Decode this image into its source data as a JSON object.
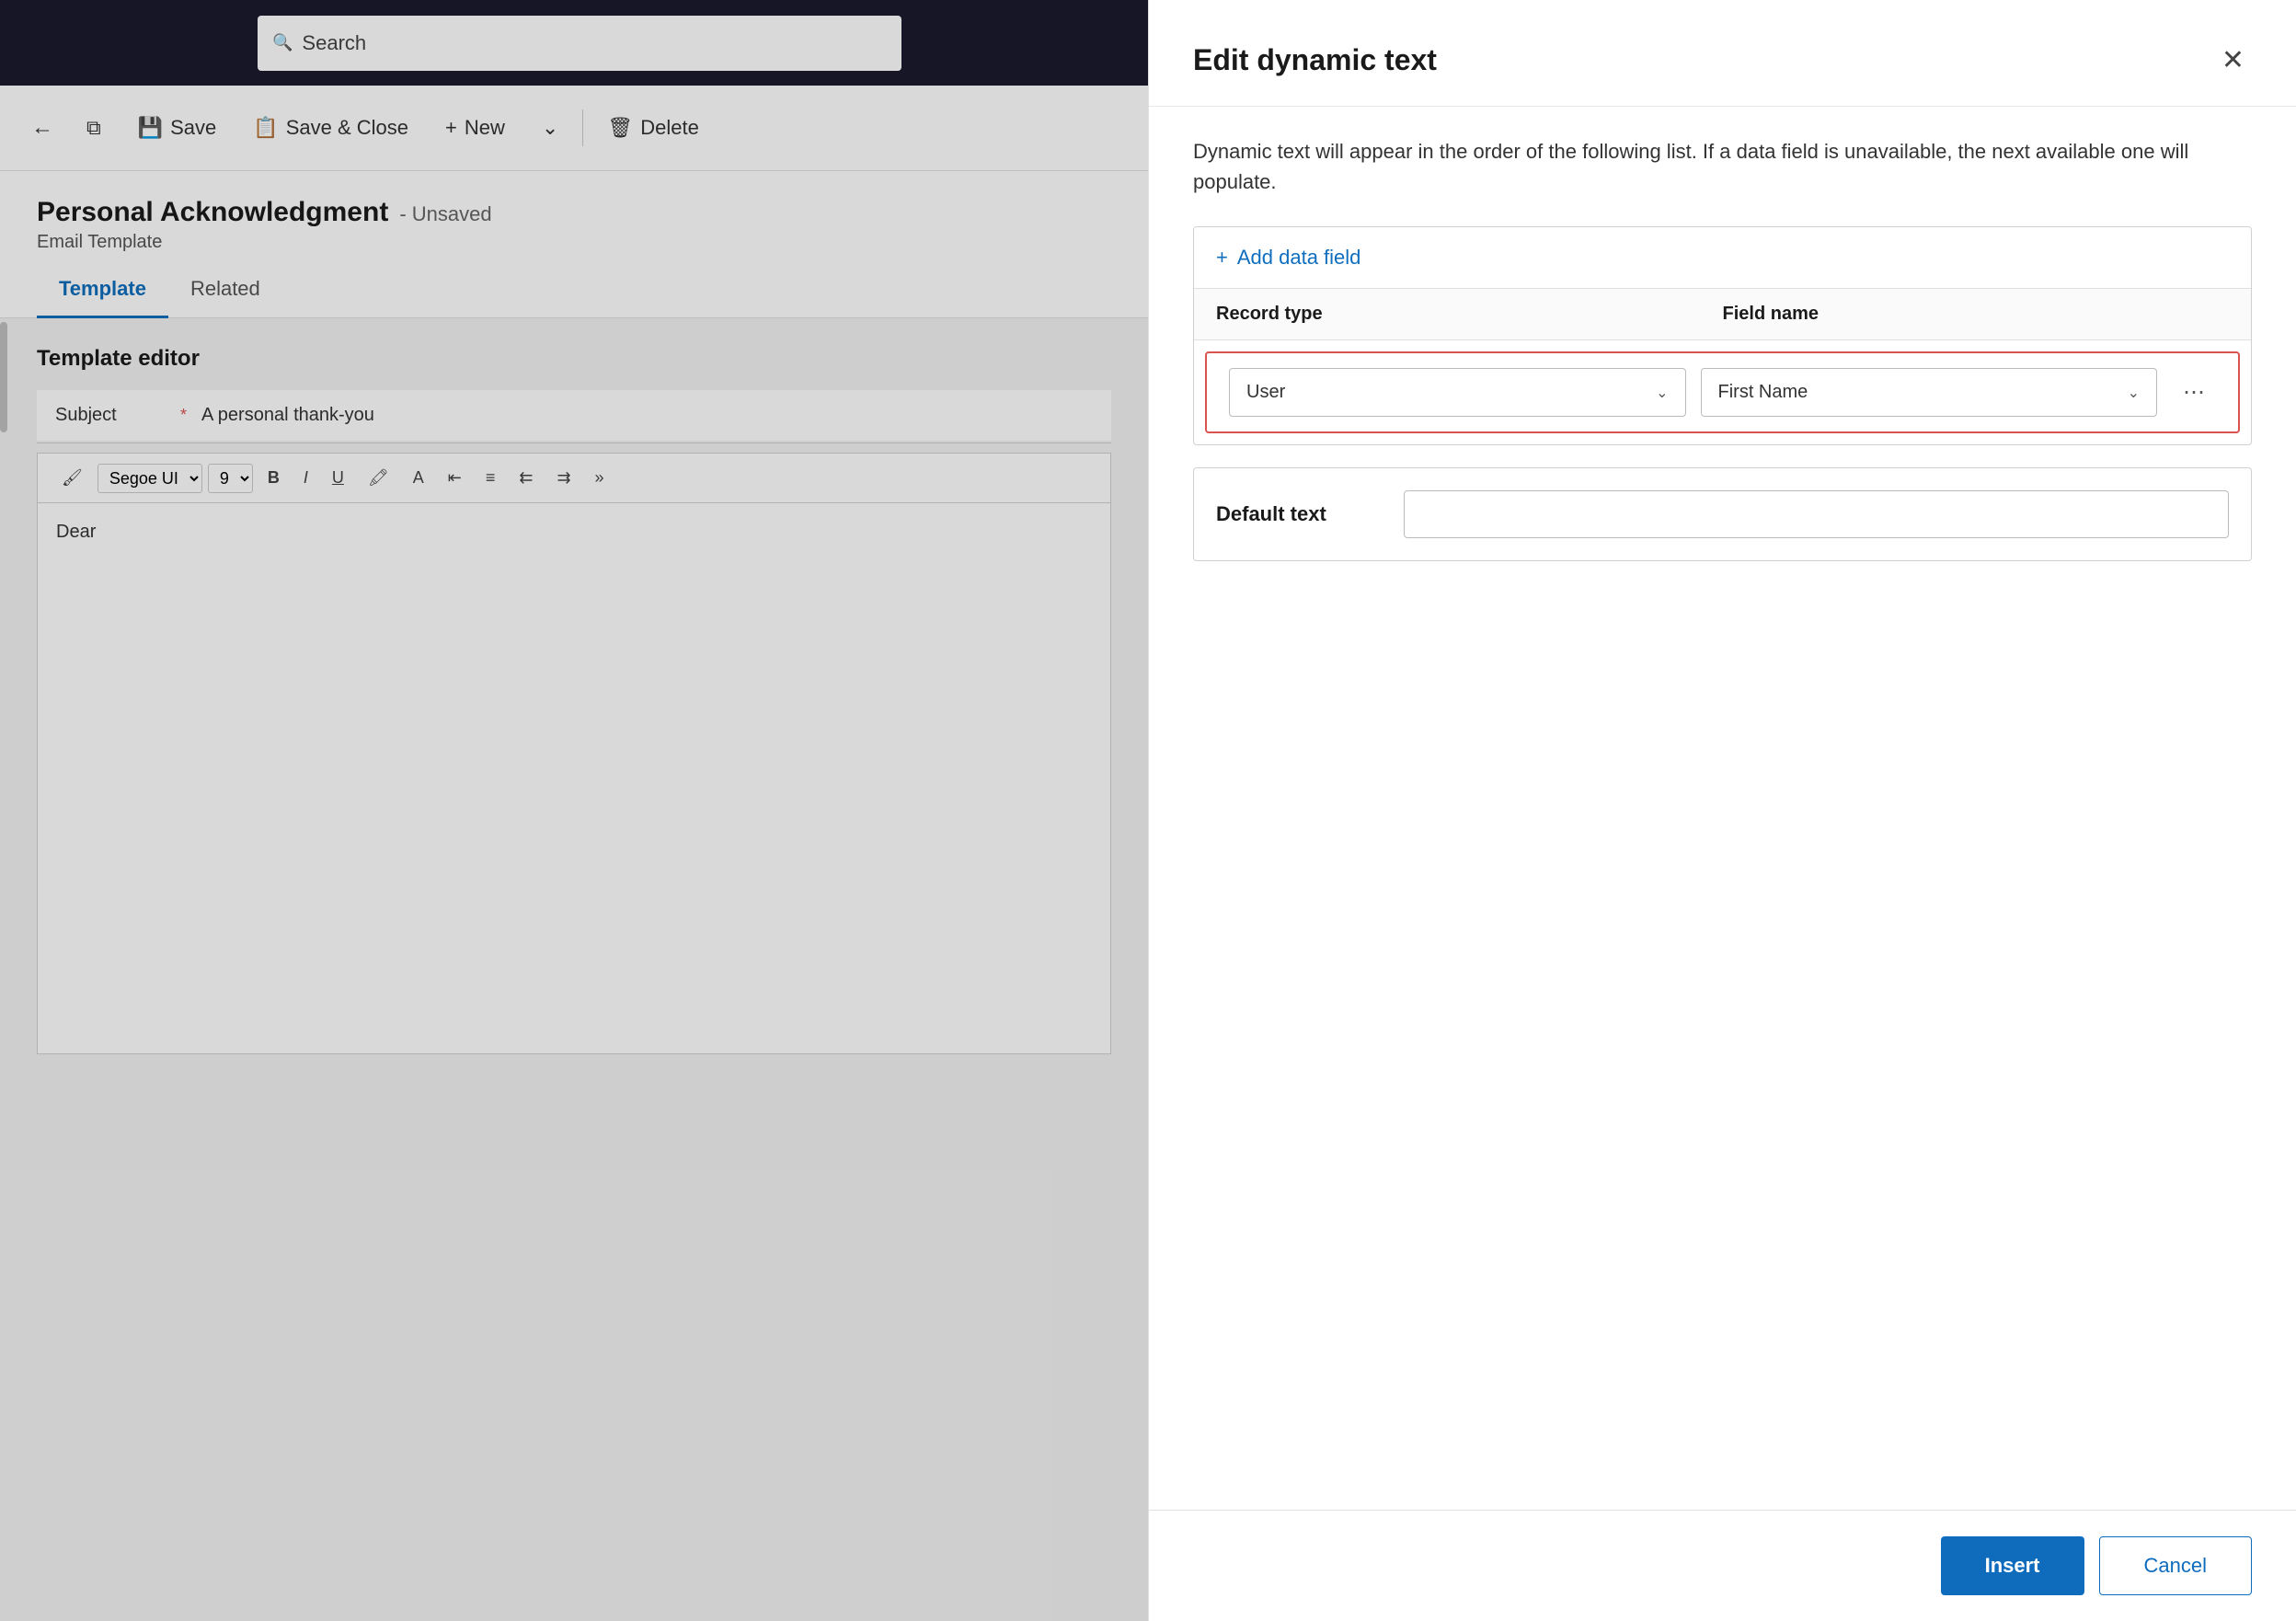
{
  "topNav": {
    "search_placeholder": "Search"
  },
  "commandBar": {
    "save_label": "Save",
    "save_close_label": "Save & Close",
    "new_label": "New",
    "delete_label": "Delete"
  },
  "pageHeader": {
    "title": "Personal Acknowledgment",
    "unsaved": "- Unsaved",
    "subtitle": "Email Template"
  },
  "tabs": [
    {
      "id": "template",
      "label": "Template",
      "active": true
    },
    {
      "id": "related",
      "label": "Related",
      "active": false
    }
  ],
  "templateEditor": {
    "section_label": "Template editor",
    "subject_label": "Subject",
    "subject_value": "A personal thank-you",
    "editor_content": "Dear",
    "font_name": "Segoe UI",
    "font_size": "9"
  },
  "dialog": {
    "title": "Edit dynamic text",
    "description": "Dynamic text will appear in the order of the following list. If a data field is unavailable, the next available one will populate.",
    "add_field_label": "Add data field",
    "col_record_type": "Record type",
    "col_field_name": "Field name",
    "record_type_value": "User",
    "field_name_value": "First Name",
    "default_text_label": "Default text",
    "default_text_placeholder": "",
    "insert_label": "Insert",
    "cancel_label": "Cancel"
  }
}
